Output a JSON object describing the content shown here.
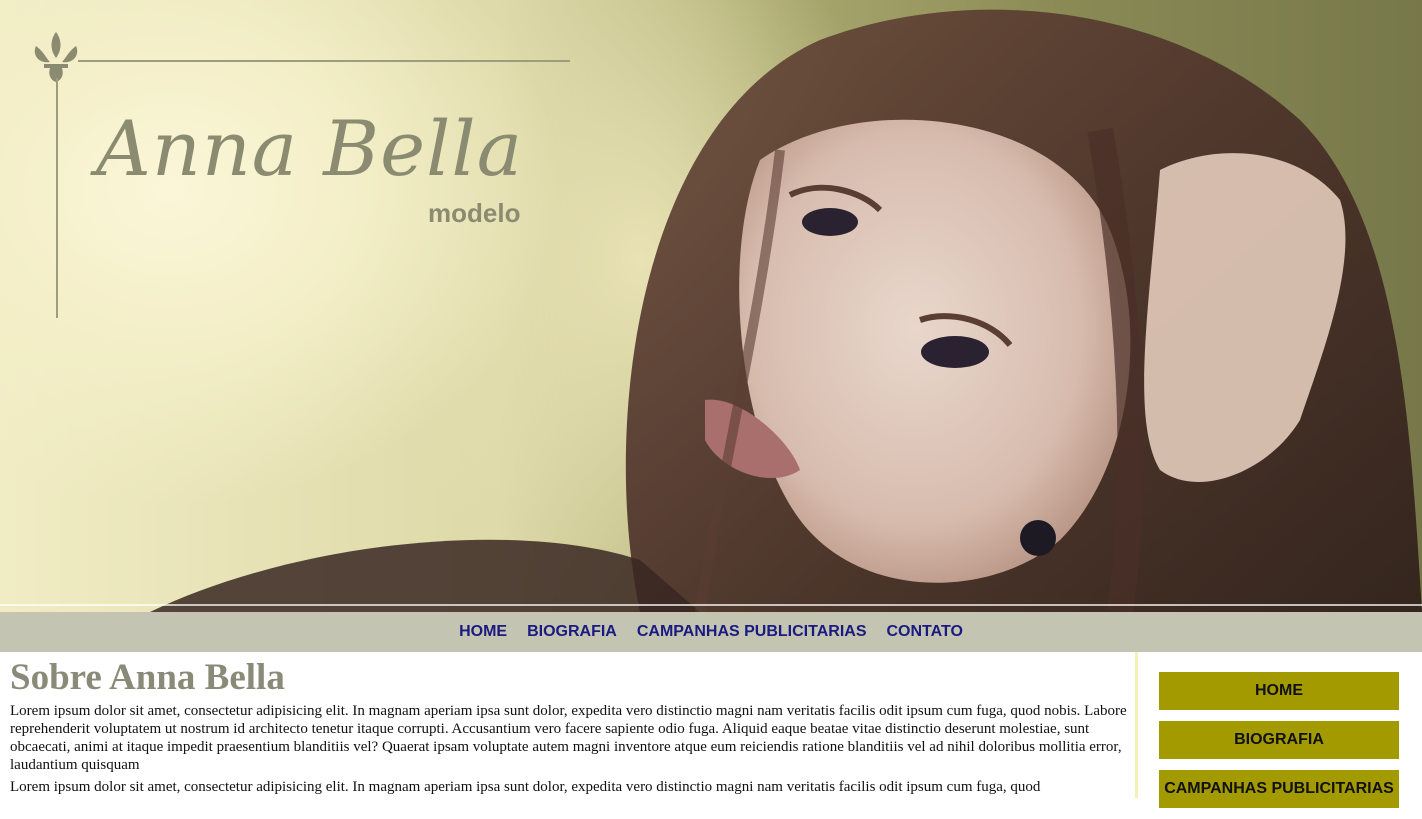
{
  "logo": {
    "name": "Anna Bella",
    "subtitle": "modelo"
  },
  "top_nav": [
    {
      "label": "HOME"
    },
    {
      "label": "BIOGRAFIA"
    },
    {
      "label": "CAMPANHAS PUBLICITARIAS"
    },
    {
      "label": "CONTATO"
    }
  ],
  "main": {
    "title": "Sobre Anna Bella",
    "paragraphs": [
      "Lorem ipsum dolor sit amet, consectetur adipisicing elit. In magnam aperiam ipsa sunt dolor, expedita vero distinctio magni nam veritatis facilis odit ipsum cum fuga, quod nobis. Labore reprehenderit voluptatem ut nostrum id architecto tenetur itaque corrupti. Accusantium vero facere sapiente odio fuga. Aliquid eaque beatae vitae distinctio deserunt molestiae, sunt obcaecati, animi at itaque impedit praesentium blanditiis vel? Quaerat ipsam voluptate autem magni inventore atque eum reiciendis ratione blanditiis vel ad nihil doloribus mollitia error, laudantium quisquam",
      "Lorem ipsum dolor sit amet, consectetur adipisicing elit. In magnam aperiam ipsa sunt dolor, expedita vero distinctio magni nam veritatis facilis odit ipsum cum fuga, quod"
    ]
  },
  "sidebar": [
    {
      "label": "HOME"
    },
    {
      "label": "BIOGRAFIA"
    },
    {
      "label": "CAMPANHAS PUBLICITARIAS"
    }
  ],
  "colors": {
    "nav_bg": "#c4c4b2",
    "nav_link": "#1a1a80",
    "sidebar_button": "#a39a00",
    "title": "#8a8a78"
  }
}
